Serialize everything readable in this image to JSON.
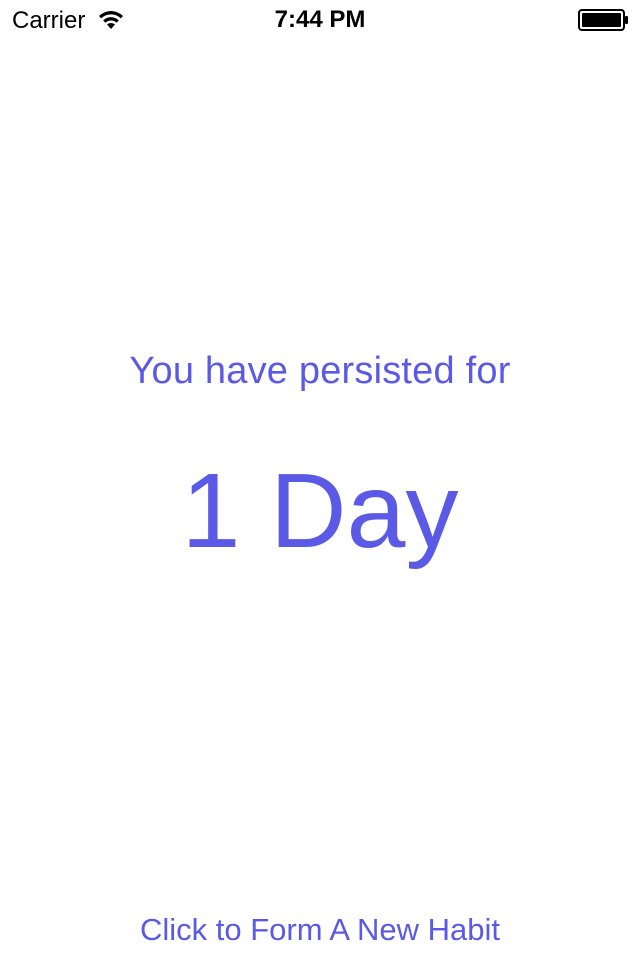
{
  "status_bar": {
    "carrier": "Carrier",
    "time": "7:44 PM",
    "wifi_icon": "wifi-icon",
    "battery_icon": "battery-icon"
  },
  "main": {
    "persisted_label": "You have persisted for",
    "day_count": "1 Day",
    "new_habit_button": "Click to Form A New Habit"
  },
  "colors": {
    "accent": "#5a5ae6",
    "background": "#ffffff"
  }
}
